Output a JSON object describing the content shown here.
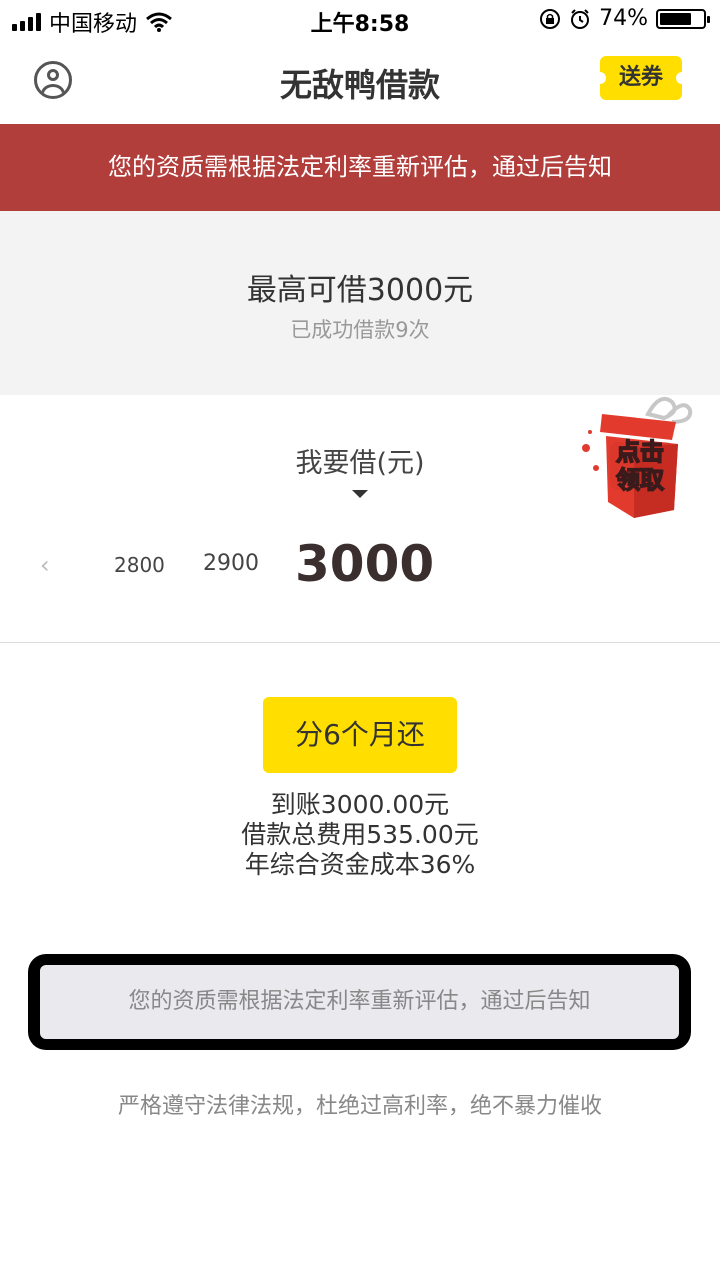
{
  "status_bar": {
    "carrier": "中国移动",
    "time": "上午8:58",
    "battery": "74%",
    "battery_level": 0.74,
    "icons": [
      "signal-icon",
      "wifi-icon",
      "rotation-lock-icon",
      "alarm-icon",
      "battery-icon"
    ]
  },
  "header": {
    "title": "无敌鸭借款",
    "coupon_label": "送券",
    "icons": [
      "user-icon"
    ]
  },
  "notice_banner": "您的资质需根据法定利率重新评估，通过后告知",
  "limit": {
    "max_text": "最高可借3000元",
    "count_text": "已成功借款9次"
  },
  "picker": {
    "label": "我要借(元)",
    "tick_partial": "",
    "values": [
      "2800",
      "2900"
    ],
    "current": "3000"
  },
  "gift": {
    "text": "点击领取"
  },
  "repay": {
    "button_label": "分6个月还",
    "info": [
      "到账3000.00元",
      "借款总费用535.00元",
      "年综合资金成本36%"
    ]
  },
  "bottom_notice": "您的资质需根据法定利率重新评估，通过后告知",
  "footer": "严格遵守法律法规，杜绝过高利率，绝不暴力催收",
  "colors": {
    "accent_yellow": "#FFDE00",
    "banner_red": "#B23E3C",
    "gift_red": "#E23B2E"
  }
}
